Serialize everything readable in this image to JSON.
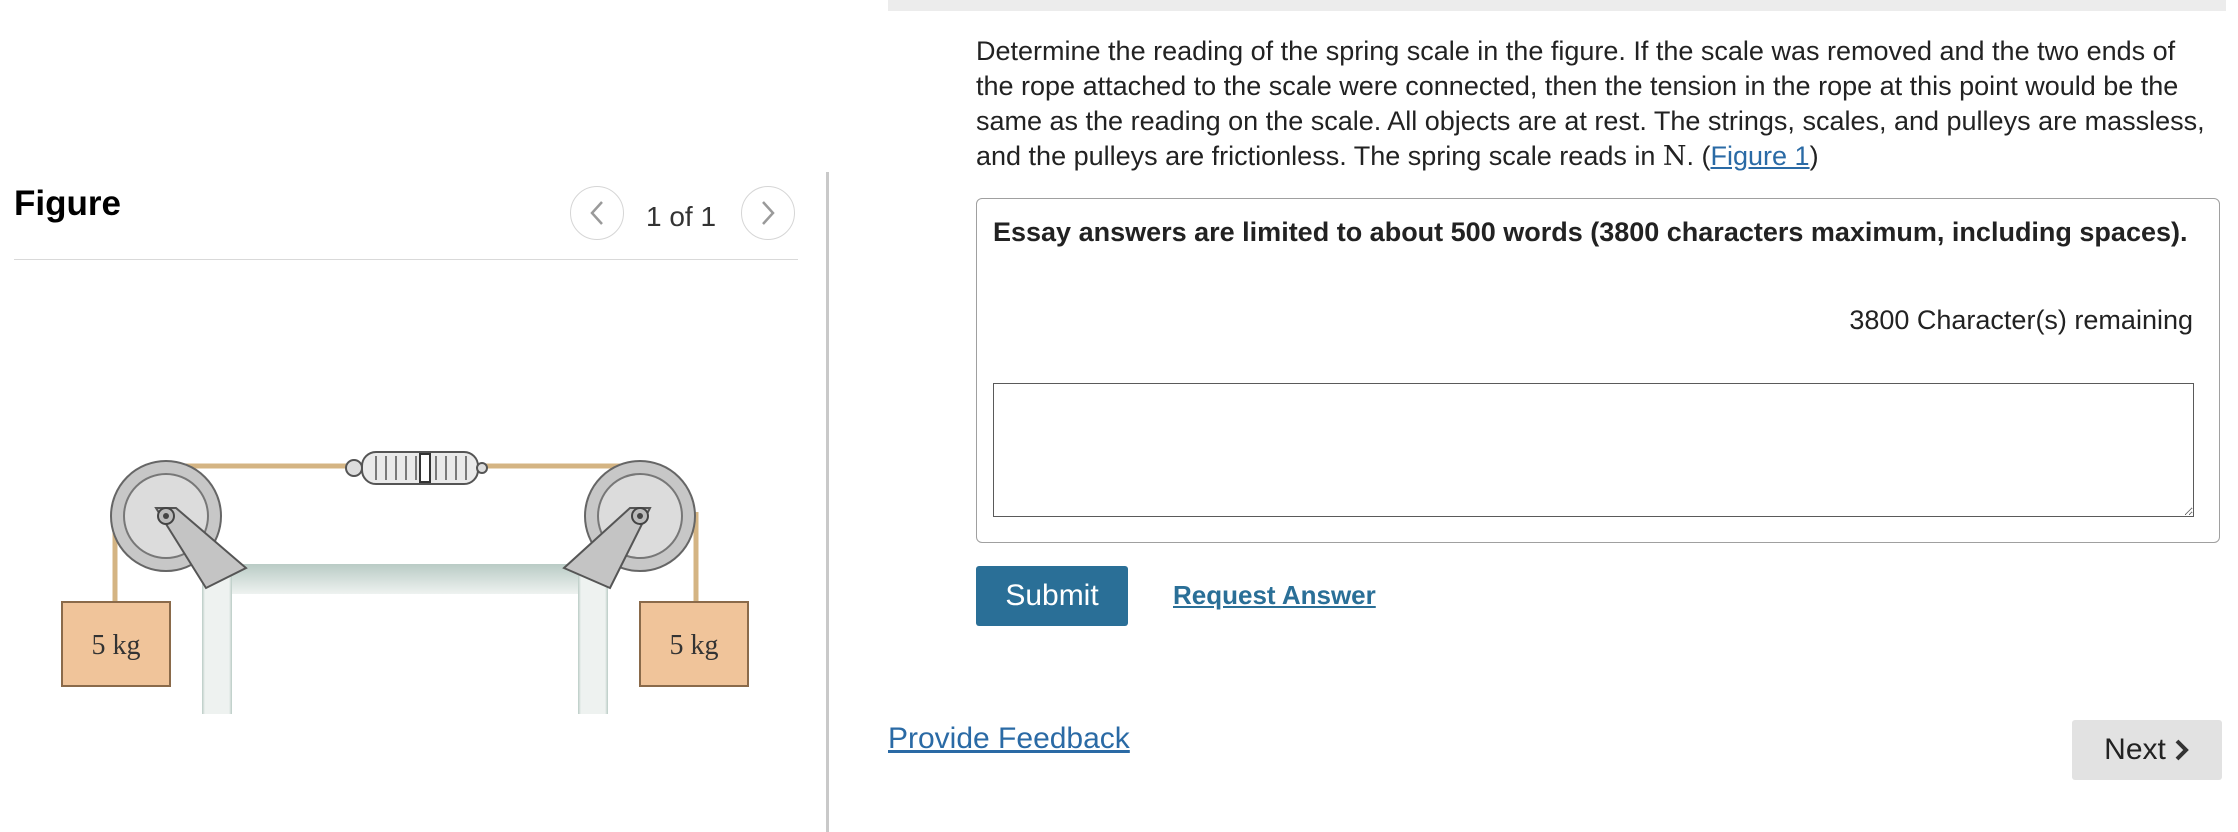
{
  "figure_panel": {
    "title": "Figure",
    "pager": "1 of 1",
    "diagram": {
      "left_mass_label": "5 kg",
      "right_mass_label": "5 kg"
    }
  },
  "question": {
    "text_before": "Determine the reading of the spring scale in the figure. If the scale was removed and the two ends of the rope attached to the scale were connected, then the tension in the rope at this point would be the same as the reading on the scale. All objects are at rest. The strings, scales, and pulleys are massless, and the pulleys are frictionless. The spring scale reads in ",
    "unit_symbol": "N",
    "text_after_unit": ". (",
    "figure_link": "Figure 1",
    "text_end": ")"
  },
  "essay": {
    "note": "Essay answers are limited to about 500 words (3800 characters maximum, including spaces).",
    "remaining": "3800 Character(s) remaining",
    "value": ""
  },
  "actions": {
    "submit_label": "Submit",
    "request_label": "Request Answer",
    "feedback_label": "Provide Feedback",
    "next_label": "Next"
  },
  "colors": {
    "submit_bg": "#2a6f97",
    "link": "#2a6aa5",
    "mass_fill": "#f0c49a"
  }
}
